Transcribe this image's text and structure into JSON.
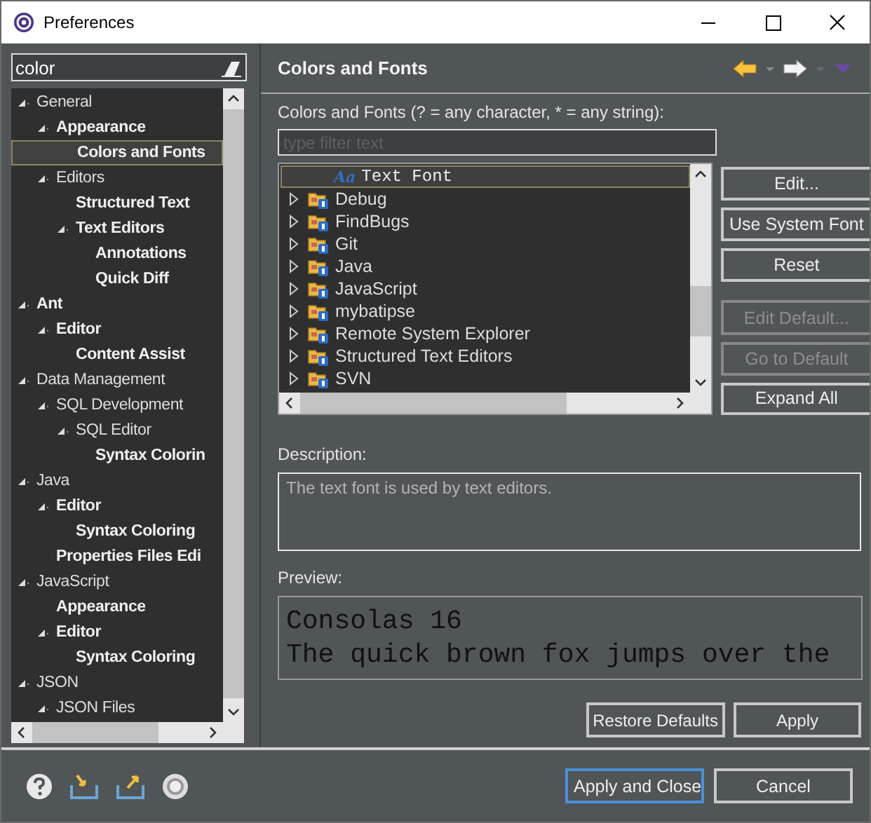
{
  "window": {
    "title": "Preferences"
  },
  "left_panel": {
    "filter": {
      "value": "color"
    },
    "tree": [
      {
        "label": "General",
        "match": false,
        "selected": false,
        "expanded": true,
        "children": [
          {
            "label": "Appearance",
            "match": true,
            "selected": false,
            "expanded": true,
            "children": [
              {
                "label": "Colors and Fonts",
                "match": true,
                "selected": true
              }
            ]
          },
          {
            "label": "Editors",
            "match": false,
            "selected": false,
            "expanded": true,
            "children": [
              {
                "label": "Structured Text",
                "match": true,
                "selected": false
              },
              {
                "label": "Text Editors",
                "match": true,
                "selected": false,
                "expanded": true,
                "children": [
                  {
                    "label": "Annotations",
                    "match": true,
                    "selected": false
                  },
                  {
                    "label": "Quick Diff",
                    "match": true,
                    "selected": false
                  }
                ]
              }
            ]
          }
        ]
      },
      {
        "label": "Ant",
        "match": true,
        "selected": false,
        "expanded": true,
        "children": [
          {
            "label": "Editor",
            "match": true,
            "selected": false,
            "expanded": true,
            "children": [
              {
                "label": "Content Assist",
                "match": true,
                "selected": false
              }
            ]
          }
        ]
      },
      {
        "label": "Data Management",
        "match": false,
        "selected": false,
        "expanded": true,
        "children": [
          {
            "label": "SQL Development",
            "match": false,
            "selected": false,
            "expanded": true,
            "children": [
              {
                "label": "SQL Editor",
                "match": false,
                "selected": false,
                "expanded": true,
                "children": [
                  {
                    "label": "Syntax Colorin",
                    "match": true,
                    "selected": false
                  }
                ]
              }
            ]
          }
        ]
      },
      {
        "label": "Java",
        "match": false,
        "selected": false,
        "expanded": true,
        "children": [
          {
            "label": "Editor",
            "match": true,
            "selected": false,
            "expanded": true,
            "children": [
              {
                "label": "Syntax Coloring",
                "match": true,
                "selected": false
              }
            ]
          },
          {
            "label": "Properties Files Edi",
            "match": true,
            "selected": false
          }
        ]
      },
      {
        "label": "JavaScript",
        "match": false,
        "selected": false,
        "expanded": true,
        "children": [
          {
            "label": "Appearance",
            "match": true,
            "selected": false
          },
          {
            "label": "Editor",
            "match": true,
            "selected": false,
            "expanded": true,
            "children": [
              {
                "label": "Syntax Coloring",
                "match": true,
                "selected": false
              }
            ]
          }
        ]
      },
      {
        "label": "JSON",
        "match": false,
        "selected": false,
        "expanded": true,
        "children": [
          {
            "label": "JSON Files",
            "match": false,
            "selected": false,
            "expanded": true
          }
        ]
      }
    ]
  },
  "page": {
    "title": "Colors and Fonts",
    "filter_label": "Colors and Fonts (? = any character, * = any string):",
    "filter": {
      "placeholder": "type filter text"
    },
    "tree": [
      {
        "kind": "font",
        "icon_label": "Aa",
        "label": "Text Font",
        "selected": true
      },
      {
        "kind": "category",
        "label": "Debug",
        "selected": false,
        "expanded": false
      },
      {
        "kind": "category",
        "label": "FindBugs",
        "selected": false,
        "expanded": false
      },
      {
        "kind": "category",
        "label": "Git",
        "selected": false,
        "expanded": false
      },
      {
        "kind": "category",
        "label": "Java",
        "selected": false,
        "expanded": false
      },
      {
        "kind": "category",
        "label": "JavaScript",
        "selected": false,
        "expanded": false
      },
      {
        "kind": "category",
        "label": "mybatipse",
        "selected": false,
        "expanded": false
      },
      {
        "kind": "category",
        "label": "Remote System Explorer",
        "selected": false,
        "expanded": false
      },
      {
        "kind": "category",
        "label": "Structured Text Editors",
        "selected": false,
        "expanded": false
      },
      {
        "kind": "category",
        "label": "SVN",
        "selected": false,
        "expanded": false
      }
    ],
    "buttons": [
      {
        "label": "Edit...",
        "disabled": false
      },
      {
        "label": "Use System Font",
        "disabled": false
      },
      {
        "label": "Reset",
        "disabled": false
      },
      {
        "label": "Edit Default...",
        "disabled": true
      },
      {
        "label": "Go to Default",
        "disabled": true
      },
      {
        "label": "Expand All",
        "disabled": false
      }
    ],
    "description_label": "Description:",
    "description": "The text font is used by text editors.",
    "preview_label": "Preview:",
    "preview_lines": [
      "Consolas 16",
      "The quick brown fox jumps over the"
    ],
    "actions": [
      "Restore Defaults",
      "Apply"
    ]
  },
  "footer": {
    "buttons": [
      {
        "label": "Apply and Close",
        "default": true
      },
      {
        "label": "Cancel",
        "default": false
      }
    ]
  }
}
